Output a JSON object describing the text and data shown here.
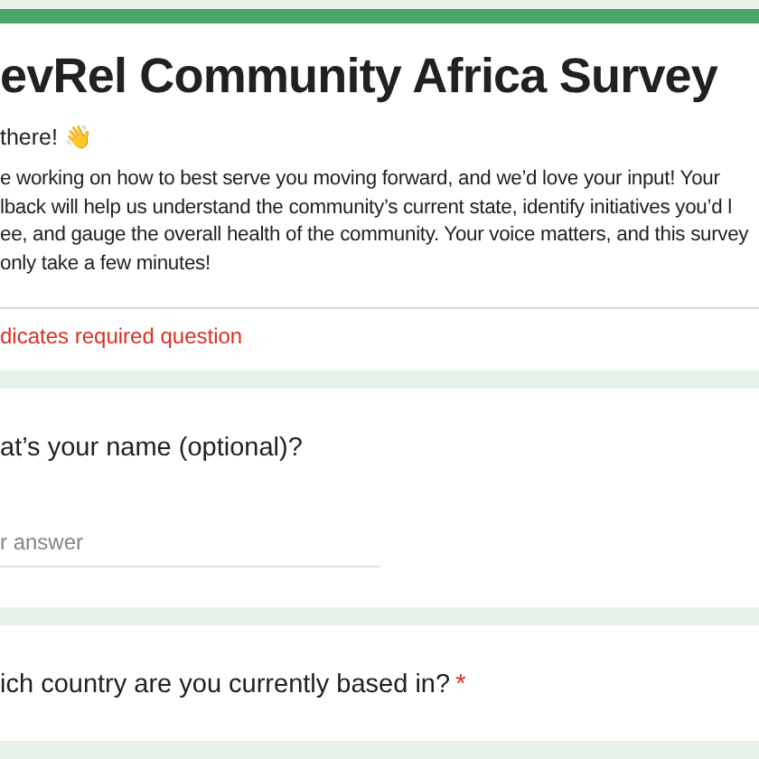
{
  "header": {
    "title": "evRel Community Africa Survey",
    "greeting": "there! 👋",
    "description_lines": [
      "e working on how to best serve you moving forward, and we’d love your input! Your",
      "lback will help us understand the community’s current state, identify initiatives you’d l",
      "ee, and gauge the overall health of the community. Your voice matters, and this survey",
      "only take a few minutes!"
    ],
    "required_note": "dicates required question"
  },
  "questions": [
    {
      "title": "at’s your name (optional)?",
      "required": false,
      "kind": "short_answer",
      "placeholder": "r answer"
    },
    {
      "title": "ich country are you currently based in?",
      "required": true,
      "kind": "none",
      "required_mark": "*"
    }
  ]
}
